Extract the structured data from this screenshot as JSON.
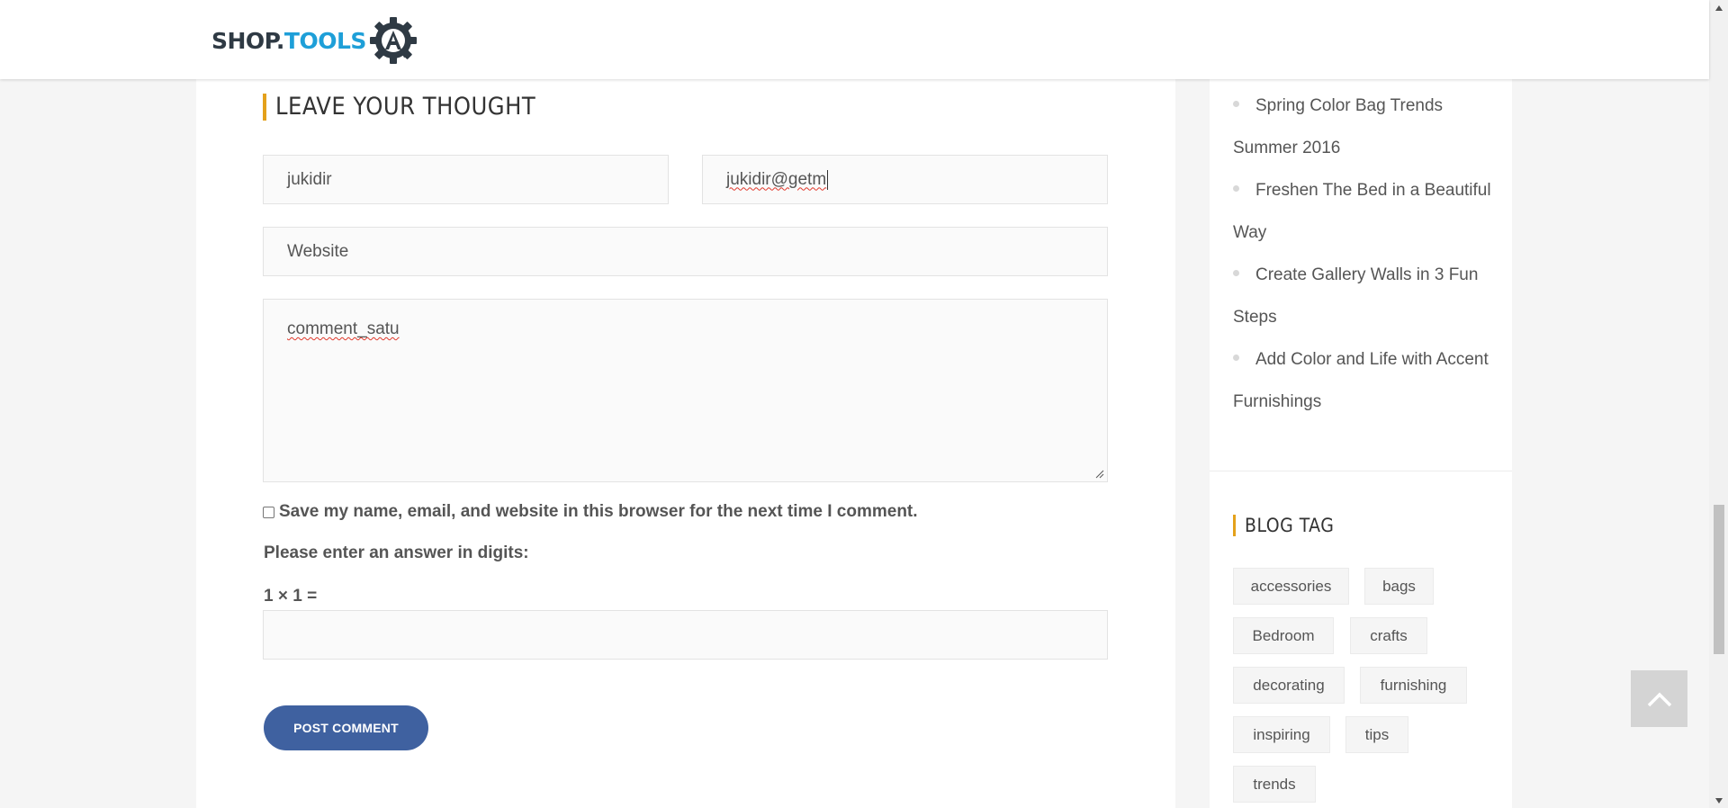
{
  "header": {
    "logo_shop": "SHOP.",
    "logo_tools": "TOOLS",
    "logo_icon": "gear-a-icon",
    "colors": {
      "shop": "#2f3a44",
      "tools": "#1e9fd8"
    }
  },
  "comment_form": {
    "title": "LEAVE YOUR THOUGHT",
    "name_value": "jukidir",
    "email_value": "jukidir@getm",
    "website_placeholder": "Website",
    "comment_value": "comment_satu",
    "save_checkbox_label": "Save my name, email, and website in this browser for the next time I comment.",
    "save_checkbox_checked": false,
    "captcha_prompt": "Please enter an answer in digits:",
    "captcha_question": "1 × 1 =",
    "captcha_value": "",
    "submit_label": "POST COMMENT",
    "accent_color": "#e4a11b",
    "button_color": "#3f61a0"
  },
  "sidebar": {
    "recent_posts": [
      "Spring Color Bag Trends Summer 2016",
      "Freshen The Bed in a Beautiful Way",
      "Create Gallery Walls in 3 Fun Steps",
      "Add Color and Life with Accent Furnishings"
    ],
    "blog_tag_title": "BLOG TAG",
    "tags": [
      "accessories",
      "bags",
      "Bedroom",
      "crafts",
      "decorating",
      "furnishing",
      "inspiring",
      "tips",
      "trends"
    ]
  },
  "back_to_top_icon": "chevron-up-icon"
}
